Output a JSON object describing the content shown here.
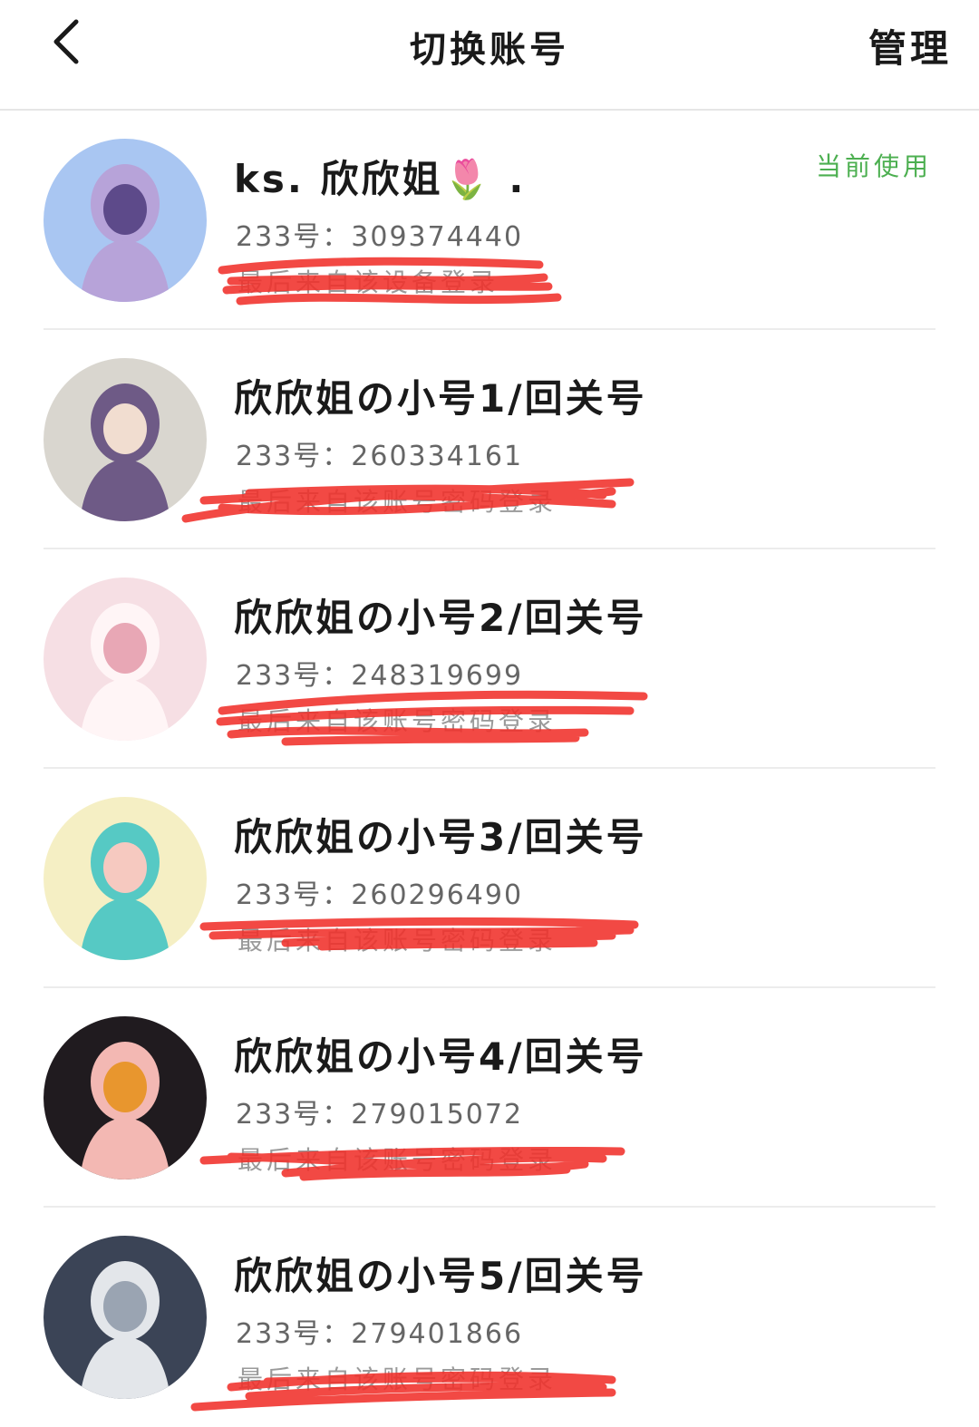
{
  "header": {
    "back_icon": "chevron-left-icon",
    "title": "切换账号",
    "manage_label": "管理"
  },
  "accent_color": "#4caf50",
  "accounts": [
    {
      "name": "ks. 欣欣姐🌷 .",
      "uid_label": "233号：",
      "uid": "309374440",
      "last_login": "最后来自该设备登录",
      "current": "当前使用",
      "avatar_colors": [
        "#a9c6f2",
        "#b7a3d9",
        "#5d4a8a"
      ]
    },
    {
      "name": "欣欣姐の小号1/回关号",
      "uid_label": "233号：",
      "uid": "260334161",
      "last_login": "最后来自该账号密码登录",
      "current": "",
      "avatar_colors": [
        "#d9d6cf",
        "#6e5a86",
        "#f1ddd0"
      ]
    },
    {
      "name": "欣欣姐の小号2/回关号",
      "uid_label": "233号：",
      "uid": "248319699",
      "last_login": "最后来自该账号密码登录",
      "current": "",
      "avatar_colors": [
        "#f6dfe4",
        "#fff5f6",
        "#e8a7b5"
      ]
    },
    {
      "name": "欣欣姐の小号3/回关号",
      "uid_label": "233号：",
      "uid": "260296490",
      "last_login": "最后来自该账号密码登录",
      "current": "",
      "avatar_colors": [
        "#f5efc4",
        "#56c9c4",
        "#f6c9c0"
      ]
    },
    {
      "name": "欣欣姐の小号4/回关号",
      "uid_label": "233号：",
      "uid": "279015072",
      "last_login": "最后来自该账号密码登录",
      "current": "",
      "avatar_colors": [
        "#201b1f",
        "#f3b8b3",
        "#e8962e"
      ]
    },
    {
      "name": "欣欣姐の小号5/回关号",
      "uid_label": "233号：",
      "uid": "279401866",
      "last_login": "最后来自该账号密码登录",
      "current": "",
      "avatar_colors": [
        "#3b4456",
        "#e3e6ea",
        "#9aa4b2"
      ]
    }
  ]
}
